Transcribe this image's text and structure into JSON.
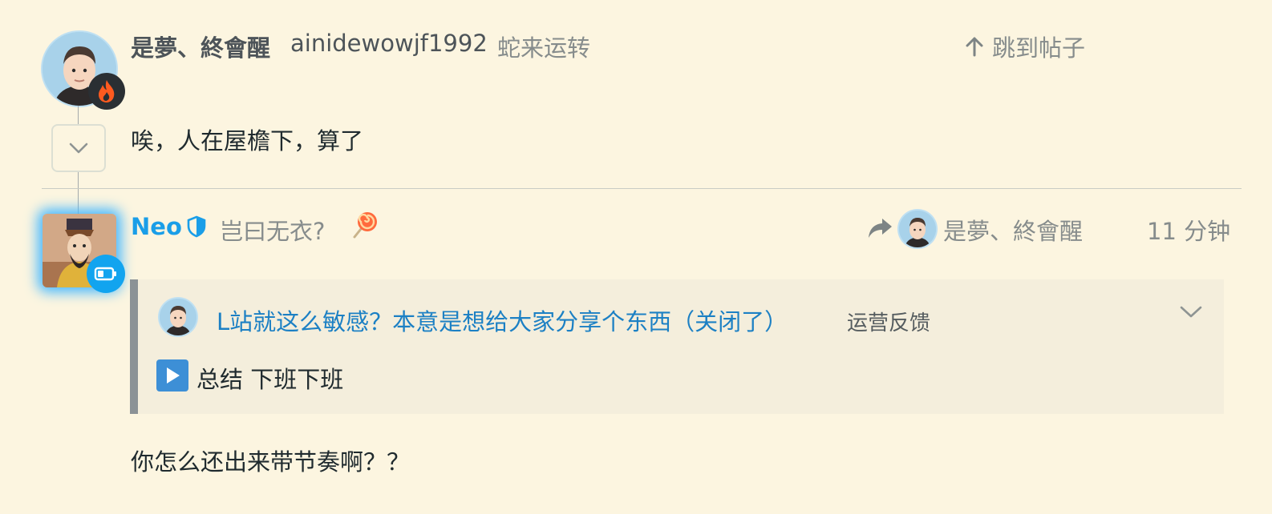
{
  "parent_post": {
    "display_name": "是夢、終會醒",
    "username": "ainidewowjf1992",
    "user_title": "蛇来运转",
    "jump_label": "跳到帖子",
    "body": "唉，人在屋檐下，算了",
    "flair_icon": "fire-icon",
    "collapse_icon": "chevron-down-icon"
  },
  "reply_post": {
    "display_name": "Neo",
    "user_title": "岂曰无衣?",
    "title_emoji": "lollipop-icon",
    "badge_icon": "shield-icon",
    "flair_icon": "battery-icon",
    "reply_to_name": "是夢、終會醒",
    "time_ago": "11 分钟",
    "quote": {
      "topic_title": "L站就这么敏感？本意是想给大家分享个东西（关闭了）",
      "category": "运营反馈",
      "body": "总结 下班下班",
      "body_emoji": "play-button-icon",
      "toggle_icon": "chevron-down-icon"
    },
    "body": "你怎么还出来带节奏啊？？"
  },
  "colors": {
    "background": "#fcf5e0",
    "accent_blue": "#1a9ee8",
    "link_blue": "#1c80c4",
    "muted_text": "#868c8c",
    "quote_bg": "#f4eedc",
    "quote_border": "#8b9296"
  }
}
